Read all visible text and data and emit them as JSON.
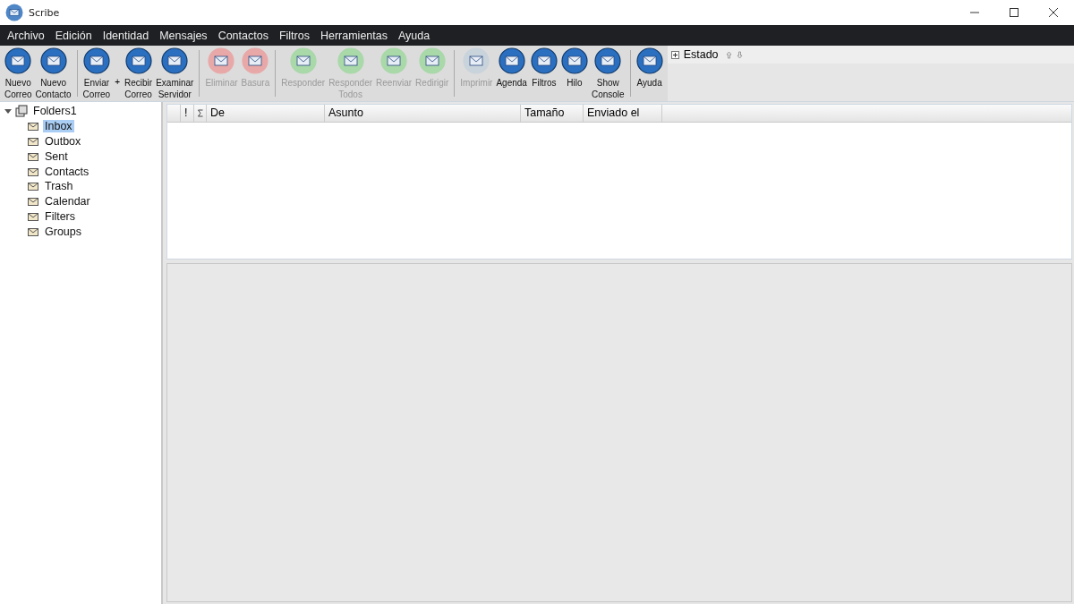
{
  "window": {
    "title": "Scribe"
  },
  "menu": [
    "Archivo",
    "Edición",
    "Identidad",
    "Mensajes",
    "Contactos",
    "Filtros",
    "Herramientas",
    "Ayuda"
  ],
  "toolbar": [
    {
      "kind": "button",
      "lines": [
        "Nuevo",
        "Correo"
      ],
      "disabled": false,
      "color": "#2a6fc0"
    },
    {
      "kind": "button",
      "lines": [
        "Nuevo",
        "Contacto"
      ],
      "disabled": false,
      "color": "#2a6fc0"
    },
    {
      "kind": "separator"
    },
    {
      "kind": "button",
      "lines": [
        "Enviar",
        "Correo"
      ],
      "disabled": false,
      "color": "#2a6fc0"
    },
    {
      "kind": "text",
      "text": "+"
    },
    {
      "kind": "button",
      "lines": [
        "Recibir",
        "Correo"
      ],
      "disabled": false,
      "color": "#2a6fc0"
    },
    {
      "kind": "button",
      "lines": [
        "Examinar",
        "Servidor"
      ],
      "disabled": false,
      "color": "#2a6fc0"
    },
    {
      "kind": "separator"
    },
    {
      "kind": "button",
      "lines": [
        "Eliminar"
      ],
      "disabled": true,
      "color": "#e8a8a8"
    },
    {
      "kind": "button",
      "lines": [
        "Basura"
      ],
      "disabled": true,
      "color": "#e8a8a8"
    },
    {
      "kind": "separator"
    },
    {
      "kind": "button",
      "lines": [
        "Responder"
      ],
      "disabled": true,
      "color": "#a9d8a9"
    },
    {
      "kind": "button",
      "lines": [
        "Responder",
        "Todos"
      ],
      "disabled": true,
      "color": "#a9d8a9"
    },
    {
      "kind": "button",
      "lines": [
        "Reenviar"
      ],
      "disabled": true,
      "color": "#a9d8a9"
    },
    {
      "kind": "button",
      "lines": [
        "Redirigir"
      ],
      "disabled": true,
      "color": "#a9d8a9"
    },
    {
      "kind": "separator"
    },
    {
      "kind": "button",
      "lines": [
        "Imprimir"
      ],
      "disabled": true,
      "color": "#c9d3dc"
    },
    {
      "kind": "button",
      "lines": [
        "Agenda"
      ],
      "disabled": false,
      "color": "#2a6fc0"
    },
    {
      "kind": "button",
      "lines": [
        "Filtros"
      ],
      "disabled": false,
      "color": "#2a6fc0"
    },
    {
      "kind": "button",
      "lines": [
        "Hilo"
      ],
      "disabled": false,
      "color": "#2a6fc0"
    },
    {
      "kind": "button",
      "lines": [
        "Show",
        "Console"
      ],
      "disabled": false,
      "color": "#2a6fc0"
    },
    {
      "kind": "separator"
    },
    {
      "kind": "button",
      "lines": [
        "Ayuda"
      ],
      "disabled": false,
      "color": "#2a6fc0"
    }
  ],
  "status": {
    "label": "Estado",
    "expanded": false
  },
  "tree": {
    "label": "Folders1",
    "expanded": true,
    "children": [
      {
        "label": "Inbox",
        "selected": true
      },
      {
        "label": "Outbox",
        "selected": false
      },
      {
        "label": "Sent",
        "selected": false
      },
      {
        "label": "Contacts",
        "selected": false
      },
      {
        "label": "Trash",
        "selected": false
      },
      {
        "label": "Calendar",
        "selected": false
      },
      {
        "label": "Filters",
        "selected": false
      },
      {
        "label": "Groups",
        "selected": false
      }
    ]
  },
  "table": {
    "columns": [
      {
        "kind": "text",
        "label": "!"
      },
      {
        "kind": "icon"
      },
      {
        "kind": "text",
        "label": "De"
      },
      {
        "kind": "text",
        "label": "Asunto"
      },
      {
        "kind": "text",
        "label": "Tamaño"
      },
      {
        "kind": "text",
        "label": "Enviado el"
      }
    ]
  }
}
